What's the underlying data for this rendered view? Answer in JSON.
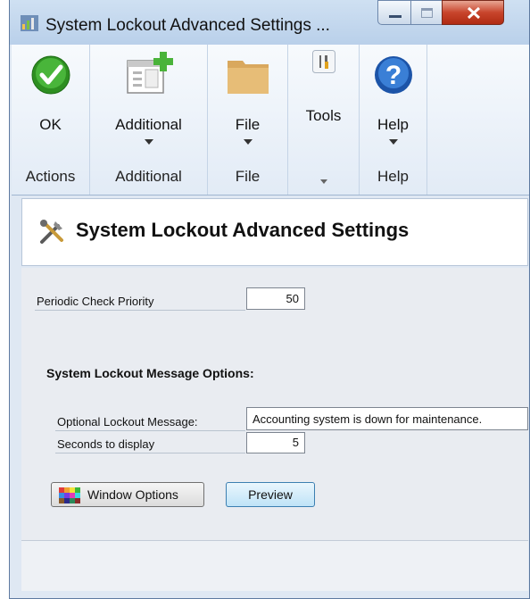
{
  "window": {
    "title": "System Lockout Advanced Settings ..."
  },
  "ribbon": {
    "groups": [
      {
        "button_label": "OK",
        "group_label": "Actions",
        "icon": "ok-checkmark-icon"
      },
      {
        "button_label": "Additional",
        "group_label": "Additional",
        "icon": "add-window-icon"
      },
      {
        "button_label": "File",
        "group_label": "File",
        "icon": "folder-icon"
      },
      {
        "button_label": "Tools",
        "group_label": "",
        "icon": "tools-icon"
      },
      {
        "button_label": "Help",
        "group_label": "Help",
        "icon": "help-icon"
      }
    ]
  },
  "header": {
    "title": "System Lockout Advanced Settings",
    "icon": "settings-tools-icon"
  },
  "form": {
    "periodic_check_priority": {
      "label": "Periodic Check Priority",
      "value": "50"
    },
    "section_title": "System Lockout Message Options:",
    "lockout_message": {
      "label": "Optional Lockout Message:",
      "value": "Accounting system is down for maintenance."
    },
    "seconds_to_display": {
      "label": "Seconds to display",
      "value": "5"
    }
  },
  "buttons": {
    "window_options": "Window Options",
    "preview": "Preview"
  },
  "colors": {
    "accent": "#2b6cc4",
    "ok_green": "#3aa32a",
    "help_blue": "#1f5fb8",
    "close_red": "#c8452c"
  }
}
